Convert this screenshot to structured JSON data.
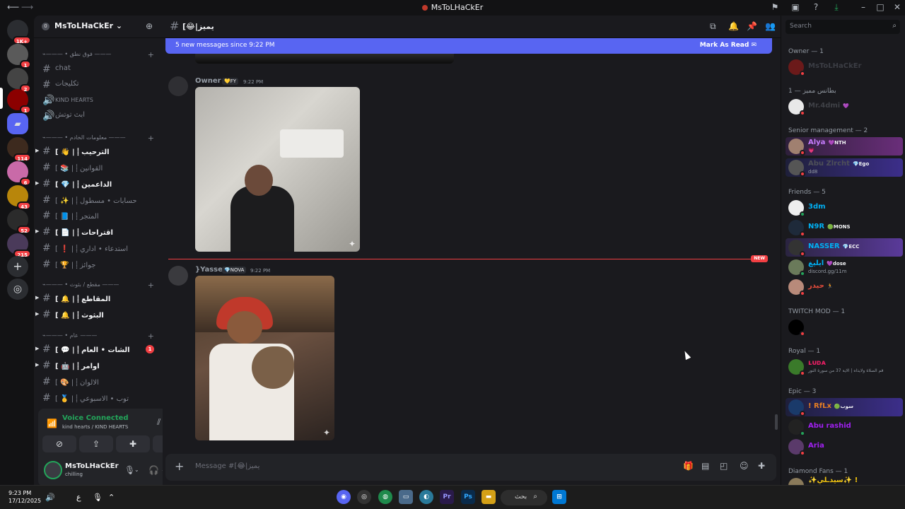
{
  "window": {
    "title": "MsToLHaCkEr"
  },
  "servers": [
    {
      "badge": "1K+"
    },
    {
      "badge": "1"
    },
    {
      "badge": "2"
    },
    {
      "badge": "1"
    },
    {
      "badge": ""
    },
    {
      "badge": "114"
    },
    {
      "badge": "6"
    },
    {
      "badge": "43"
    },
    {
      "badge": "52"
    },
    {
      "badge": "215"
    }
  ],
  "guild": {
    "name": "MsToLHaCkEr"
  },
  "categories": [
    {
      "label": "⌁——— • فوق نطق ———"
    },
    {
      "label": "⌁——— • معلومات الخادم ———"
    },
    {
      "label": "⌁——— • مقطع / بثوث ———"
    },
    {
      "label": "⌁——— • عام ———"
    }
  ],
  "channels": [
    {
      "label": "chat"
    },
    {
      "label": "تكليجات"
    },
    {
      "label": "KIND HEARTS"
    },
    {
      "label": "ابث توتش"
    },
    {
      "label": "[ 👋 | ⸽ الترحيب"
    },
    {
      "label": "[ 📚 | ⸽ القوانين"
    },
    {
      "label": "[ 💎 | ⸽ الداعمين"
    },
    {
      "label": "[ ✨ | ⸽ حسابات • مسطول"
    },
    {
      "label": "[ 📘 | ⸽ المتجر"
    },
    {
      "label": "[ 📄 | ⸽ اقتراحات"
    },
    {
      "label": "[ ❗ | ⸽ استدعاء • اداري"
    },
    {
      "label": "[ 🏆 | ⸽ جوائز"
    },
    {
      "label": "[ 🔔 | ⸽ المقاطع"
    },
    {
      "label": "[ 🔔 | ⸽ البثوث"
    },
    {
      "label": "[ 💬 | ⸽ الشات • العام",
      "mention": "1"
    },
    {
      "label": "[ 🤖 | ⸽ اوامر"
    },
    {
      "label": "[ 🎨 | ⸽ الالوان"
    },
    {
      "label": "[ 🥇 | ⸽ توب • الاسبوعي"
    }
  ],
  "voice": {
    "title": "Voice Connected",
    "subtitle": "kind hearts / KIND HEARTS"
  },
  "user": {
    "name": "MsToLHaCkEr",
    "status": "chilling"
  },
  "channel": {
    "name": "[😂|يميز"
  },
  "banner": {
    "text": "5 new messages since 9:22 PM",
    "action": "Mark As Read"
  },
  "messages": [
    {
      "author": "Owner",
      "tag": "💛FY",
      "time": "9:22 PM",
      "color": "#949ba4"
    },
    {
      "author": "}Yasser",
      "tag": "💎NOVA",
      "time": "9:22 PM",
      "color": "#949ba4"
    }
  ],
  "new_label": "NEW",
  "composer": {
    "placeholder": "Message #[😂|يميز"
  },
  "members": {
    "search_placeholder": "Search",
    "groups": [
      {
        "title": "Owner — 1"
      },
      {
        "title": "1 — بطانس مميز"
      },
      {
        "title": "Senior management — 2"
      },
      {
        "title": "Friends — 5"
      },
      {
        "title": "TWITCH MOD — 1"
      },
      {
        "title": "Royal — 1"
      },
      {
        "title": "Epic — 3"
      },
      {
        "title": "Diamond Fans — 1"
      }
    ],
    "list": [
      {
        "name": "MsToLHaCkEr",
        "color": "#3b3d44",
        "tag": "",
        "sub": ""
      },
      {
        "name": "Mr.4dmi",
        "color": "#3f4147",
        "tag": "💜",
        "sub": ""
      },
      {
        "name": "Alya",
        "color": "#c77dff",
        "tag": "💜NTH",
        "sub": "💗"
      },
      {
        "name": "Abu Zlrcht",
        "color": "#4e5058",
        "tag": "💎Ego",
        "sub": "dd8"
      },
      {
        "name": "3dm",
        "color": "#00b0f4",
        "tag": "",
        "sub": ""
      },
      {
        "name": "N9R",
        "color": "#00b0f4",
        "tag": "🟢MONS",
        "sub": ""
      },
      {
        "name": "NASSER",
        "color": "#00b0f4",
        "tag": "💎ECC",
        "sub": ""
      },
      {
        "name": "ايليغ",
        "color": "#00b0f4",
        "tag": "💜dose",
        "sub": "discord.gg/11m"
      },
      {
        "name": "حيدر",
        "color": "#e74c3c",
        "tag": "🏃",
        "sub": ""
      },
      {
        "name": "",
        "color": "#b5bac1",
        "tag": "",
        "sub": ""
      },
      {
        "name": "ʟᴜᴅᴀ",
        "color": "#e91e63",
        "tag": "",
        "sub": "قم الصلاة ولايذاه | الاية 37 من سورة النور"
      },
      {
        "name": "! RfLx",
        "color": "#e67e22",
        "tag": "🟢سوب",
        "sub": ""
      },
      {
        "name": "Abu rashid",
        "color": "#a020f0",
        "tag": "",
        "sub": ""
      },
      {
        "name": "Aria",
        "color": "#a020f0",
        "tag": "",
        "sub": ""
      },
      {
        "name": "✨سيدـلي✨ !",
        "color": "#f1c40f",
        "tag": "",
        "sub": ""
      }
    ]
  },
  "taskbar": {
    "time": "9:23 PM",
    "date": "17/12/2025",
    "lang": "ع",
    "search": "بحث",
    "apps": [
      "Pr",
      "Ps"
    ]
  },
  "colors": {
    "accent": "#5865f2",
    "online": "#23a55a",
    "dnd": "#f23f43",
    "background": "#1a1a1e"
  }
}
